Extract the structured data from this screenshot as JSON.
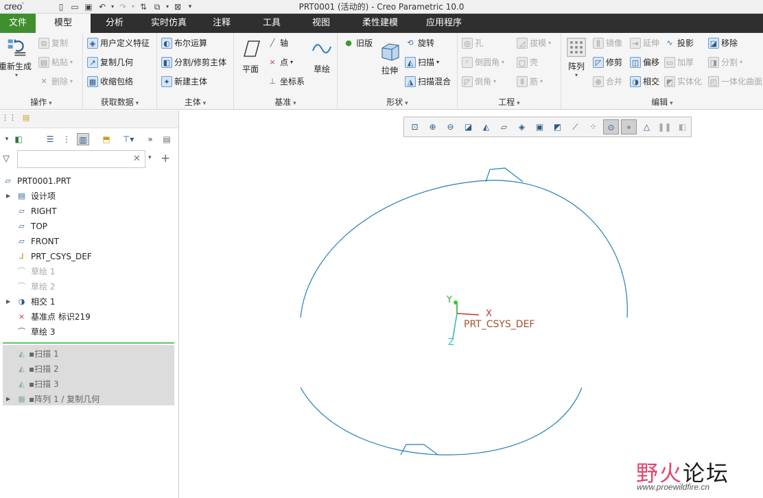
{
  "app": {
    "logo": "creo",
    "window_title": "PRT0001 (活动的) - Creo Parametric 10.0"
  },
  "qat_icons": [
    "new-icon",
    "open-icon",
    "save-icon",
    "undo-icon",
    "redo-icon",
    "regenerate-icon",
    "windows-icon",
    "close-icon",
    "customize-icon"
  ],
  "tabs": [
    {
      "label": "文件"
    },
    {
      "label": "模型"
    },
    {
      "label": "分析"
    },
    {
      "label": "实时仿真"
    },
    {
      "label": "注释"
    },
    {
      "label": "工具"
    },
    {
      "label": "视图"
    },
    {
      "label": "柔性建模"
    },
    {
      "label": "应用程序"
    }
  ],
  "ribbon": {
    "operations": {
      "label": "操作",
      "regenerate": "重新生成",
      "copy": "复制",
      "paste": "粘贴",
      "delete": "删除"
    },
    "get_data": {
      "label": "获取数据",
      "udf": "用户定义特征",
      "copy_geom": "复制几何",
      "shrinkwrap": "收缩包络"
    },
    "body": {
      "label": "主体",
      "boolean": "布尔运算",
      "split_trim": "分割/修剪主体",
      "new_body": "新建主体"
    },
    "datum": {
      "label": "基准",
      "plane": "平面",
      "axis": "轴",
      "point": "点",
      "csys": "坐标系",
      "sketch": "草绘"
    },
    "shapes": {
      "label": "形状",
      "legacy": "旧版",
      "extrude": "拉伸",
      "revolve": "旋转",
      "sweep": "扫描",
      "swept_blend": "扫描混合"
    },
    "engineering": {
      "label": "工程",
      "hole": "孔",
      "round": "倒圆角",
      "chamfer": "倒角",
      "draft": "拔模",
      "shell": "壳",
      "rib": "筋"
    },
    "editing": {
      "label": "编辑",
      "pattern": "阵列",
      "mirror": "镜像",
      "trim": "修剪",
      "merge": "合并",
      "extend": "延伸",
      "offset": "偏移",
      "intersect": "相交",
      "project": "投影",
      "thicken": "加厚",
      "solidify": "实体化",
      "remove": "移除",
      "split": "分割",
      "unify": "一体化曲面"
    }
  },
  "model_tree": {
    "search_placeholder": "",
    "items": [
      {
        "label": "PRT0001.PRT",
        "icon": "part-icon"
      },
      {
        "label": "设计项",
        "icon": "design-items-icon"
      },
      {
        "label": "RIGHT",
        "icon": "datum-plane-icon"
      },
      {
        "label": "TOP",
        "icon": "datum-plane-icon"
      },
      {
        "label": "FRONT",
        "icon": "datum-plane-icon"
      },
      {
        "label": "PRT_CSYS_DEF",
        "icon": "csys-icon"
      },
      {
        "label": "草绘 1",
        "icon": "sketch-icon"
      },
      {
        "label": "草绘 2",
        "icon": "sketch-icon"
      },
      {
        "label": "相交 1",
        "icon": "intersect-icon"
      },
      {
        "label": "基准点 标识219",
        "icon": "datum-point-icon"
      },
      {
        "label": "草绘 3",
        "icon": "sketch-icon"
      },
      {
        "label": "扫描 1",
        "icon": "sweep-icon"
      },
      {
        "label": "扫描 2",
        "icon": "sweep-icon"
      },
      {
        "label": "扫描 3",
        "icon": "sweep-icon"
      },
      {
        "label": "阵列 1 / 复制几何",
        "icon": "pattern-icon"
      }
    ]
  },
  "graphics": {
    "csys_label": "PRT_CSYS_DEF",
    "axis_x": "X",
    "axis_y": "Y",
    "axis_z": "Z",
    "curve_color": "#1f7fb0"
  },
  "watermark": {
    "text_a": "野火",
    "text_b": "论坛",
    "url": "www.proewildfire.cn"
  }
}
